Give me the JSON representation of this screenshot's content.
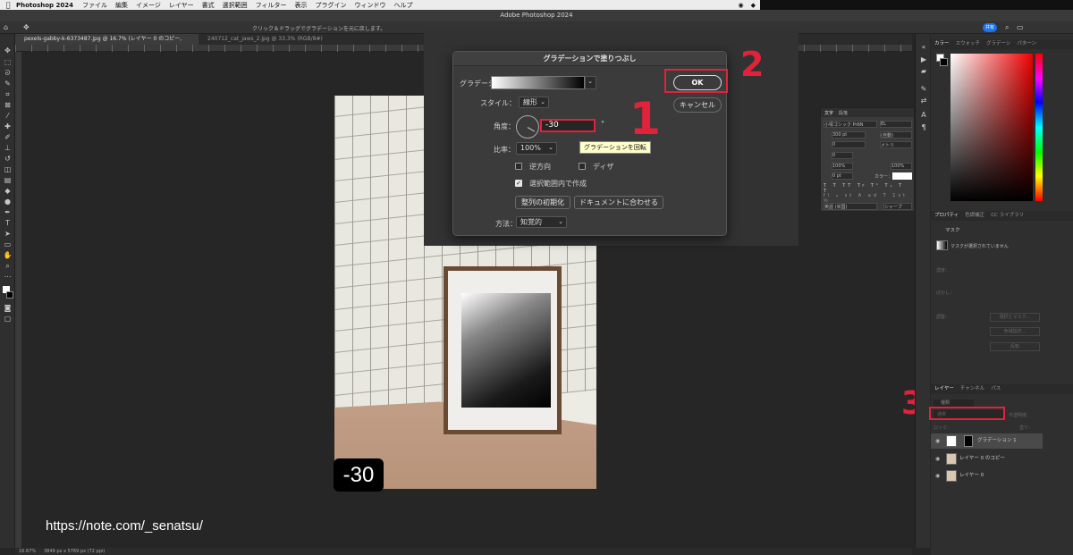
{
  "menubar": {
    "app": "Photoshop 2024",
    "items": [
      "ファイル",
      "編集",
      "イメージ",
      "レイヤー",
      "書式",
      "選択範囲",
      "フィルター",
      "表示",
      "プラグイン",
      "ウィンドウ",
      "ヘルプ"
    ]
  },
  "window_title": "Adobe Photoshop 2024",
  "options_hint": "クリック＆ドラッグでグラデーションを元に戻します。",
  "share_label": "共有",
  "tabs": [
    {
      "label": "pexels-gabby-k-6373487.jpg @ 16.7% (レイヤー 0 のコピー, RGB/8) *"
    },
    {
      "label": "240712_cat_jaws_2.jpg @ 33.3% (RGB/8#)"
    }
  ],
  "statusbar": {
    "zoom": "16.67%",
    "info": "3849 px x 5769 px (72 ppi)"
  },
  "dialog": {
    "title": "グラデーションで塗りつぶし",
    "gradient_label": "グラデーション：",
    "style_label": "スタイル：",
    "style_value": "線形",
    "angle_label": "角度：",
    "angle_value": "-30",
    "degree_symbol": "°",
    "tooltip": "グラデーションを回転",
    "scale_label": "比率：",
    "scale_value": "100%",
    "reverse_label": "逆方向",
    "dither_label": "ディザ",
    "within_selection_label": "選択範囲内で作成",
    "reset_alignment": "整列の初期化",
    "align_document": "ドキュメントに合わせる",
    "method_label": "方法：",
    "method_value": "知覚的",
    "ok": "OK",
    "cancel": "キャンセル"
  },
  "annotations": {
    "one": "1",
    "two": "2",
    "three": "3"
  },
  "badge": "-30",
  "url_text": "https://note.com/_senatsu/",
  "character_panel": {
    "tabs": [
      "文字",
      "段落"
    ],
    "font": "小塚ゴシック Pr6N",
    "weight": "EL",
    "size": "300 pt",
    "leading": "(自動)",
    "tracking": "0",
    "kerning": "メトリ",
    "vscale": "100%",
    "hscale": "100%",
    "baseline": "0 pt",
    "color_label": "カラー：",
    "language": "英語 (米国)",
    "aa": "シャープ"
  },
  "color_panel": {
    "tabs": [
      "カラー",
      "スウォッチ",
      "グラデーシ",
      "パターン"
    ]
  },
  "properties_panel": {
    "tabs": [
      "プロパティ",
      "色調補正",
      "CC ライブラリ"
    ],
    "mask_label": "マスク",
    "mask_status": "マスクが選択されていません",
    "density": "濃度：",
    "feather": "ぼかし：",
    "adjust": "調整：",
    "select_mask": "選択とマスク...",
    "color_range": "色域指定...",
    "invert": "反転"
  },
  "layers_panel": {
    "tabs": [
      "レイヤー",
      "チャンネル",
      "パス"
    ],
    "search": "種類",
    "blend_mode": "通常",
    "opacity_label": "不透明度：",
    "lock_label": "ロック：",
    "fill_label": "塗り：",
    "layers": [
      {
        "name": "グラデーション 1",
        "selected": true
      },
      {
        "name": "レイヤー 0 のコピー",
        "selected": false
      },
      {
        "name": "レイヤー 0",
        "selected": false
      }
    ]
  }
}
